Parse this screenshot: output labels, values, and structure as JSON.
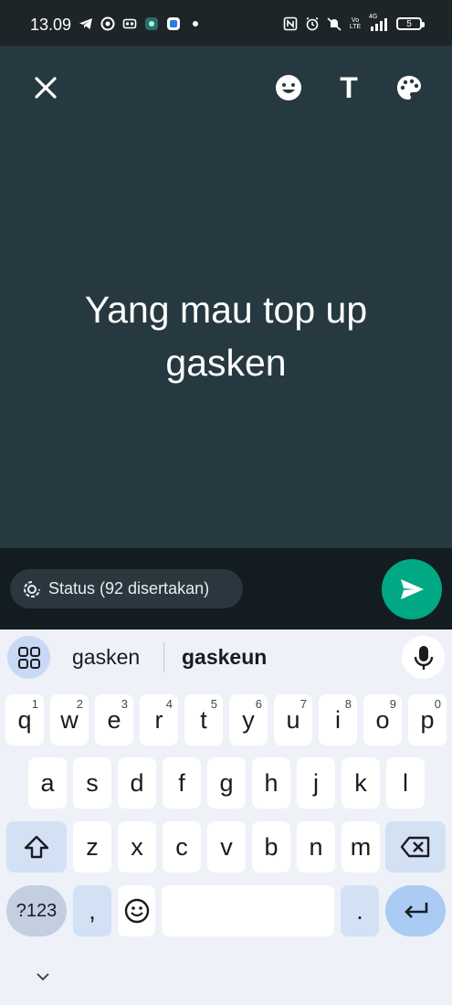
{
  "status_bar": {
    "time": "13.09",
    "battery_level": "5",
    "left_icons": [
      "telegram-icon",
      "chrome-icon",
      "cast-icon",
      "app-icon",
      "app-icon",
      "dot-icon"
    ],
    "right_icons": [
      "nfc-icon",
      "alarm-icon",
      "mute-icon",
      "volte-icon",
      "signal-4g-icon",
      "battery-icon"
    ],
    "volte_label": "Vo LTE",
    "network_label": "4G"
  },
  "editor": {
    "text": "Yang mau top up gasken",
    "text_line1": "Yang mau top up",
    "text_line2": "gasken",
    "background_color": "#263840",
    "tools": [
      "close-icon",
      "emoji-icon",
      "text-icon",
      "palette-icon"
    ],
    "text_tool_label": "T"
  },
  "compose": {
    "audience_label": "Status (92 disertakan)",
    "send_color": "#00a884"
  },
  "keyboard": {
    "suggestions": [
      "gasken",
      "gaskeun"
    ],
    "row1": [
      {
        "k": "q",
        "h": "1"
      },
      {
        "k": "w",
        "h": "2"
      },
      {
        "k": "e",
        "h": "3"
      },
      {
        "k": "r",
        "h": "4"
      },
      {
        "k": "t",
        "h": "5"
      },
      {
        "k": "y",
        "h": "6"
      },
      {
        "k": "u",
        "h": "7"
      },
      {
        "k": "i",
        "h": "8"
      },
      {
        "k": "o",
        "h": "9"
      },
      {
        "k": "p",
        "h": "0"
      }
    ],
    "row2": [
      "a",
      "s",
      "d",
      "f",
      "g",
      "h",
      "j",
      "k",
      "l"
    ],
    "row3": [
      "z",
      "x",
      "c",
      "v",
      "b",
      "n",
      "m"
    ],
    "symbols_label": "?123",
    "comma_label": ",",
    "period_label": "."
  }
}
